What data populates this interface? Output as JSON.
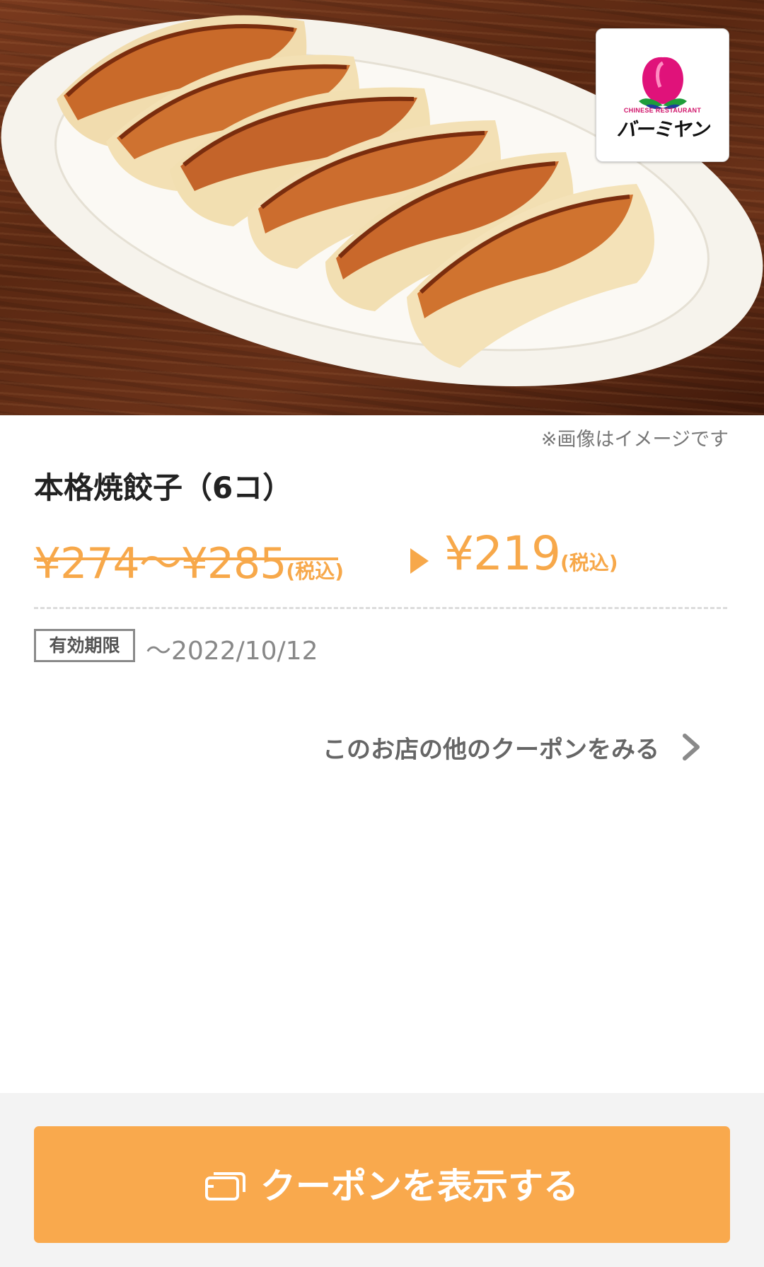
{
  "hero": {
    "image_note": "※画像はイメージです",
    "logo": {
      "subtitle": "CHINESE RESTAURANT",
      "name": "バーミヤン"
    }
  },
  "item": {
    "title": "本格焼餃子（6コ）"
  },
  "price": {
    "original": "¥274〜¥285",
    "original_tax": "(税込)",
    "discounted": "¥219",
    "discounted_tax": "(税込)"
  },
  "validity": {
    "label": "有効期限",
    "date": "〜2022/10/12"
  },
  "links": {
    "other_coupons": "このお店の他のクーポンをみる"
  },
  "footer": {
    "show_coupon_button": "クーポンを表示する"
  },
  "colors": {
    "accent": "#f9a94d",
    "price": "#f7a84a",
    "logo_pink": "#e0127a"
  },
  "icons": {
    "other_coupons_chevron": "chevron-right-icon",
    "coupon_button": "coupon-cards-icon"
  }
}
